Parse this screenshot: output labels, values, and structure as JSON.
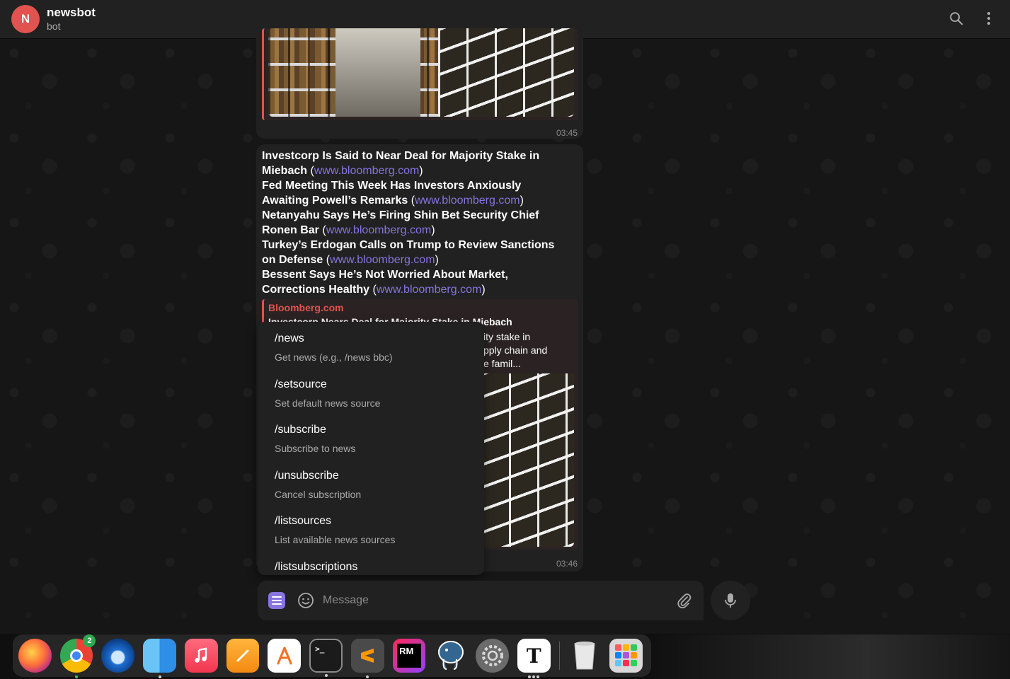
{
  "header": {
    "avatar_letter": "N",
    "title": "newsbot",
    "subtitle": "bot",
    "icons": [
      "search-icon",
      "more-vertical-icon"
    ]
  },
  "messages": {
    "first": {
      "time": "03:45"
    },
    "second": {
      "headlines": [
        {
          "title": "Investcorp Is Said to Near Deal for Majority Stake in Miebach",
          "link": "www.bloomberg.com"
        },
        {
          "title": "Fed Meeting This Week Has Investors Anxiously Awaiting Powell’s Remarks",
          "link": "www.bloomberg.com"
        },
        {
          "title": "Netanyahu Says He’s Firing Shin Bet Security Chief Ronen Bar",
          "link": "www.bloomberg.com"
        },
        {
          "title": "Turkey’s Erdogan Calls on Trump to Review Sanctions on Defense",
          "link": "www.bloomberg.com"
        },
        {
          "title": "Bessent Says He’s Not Worried About Market, Corrections Healthy",
          "link": "www.bloomberg.com"
        }
      ],
      "preview": {
        "site": "Bloomberg.com",
        "headline_partial": "Investcorp Nears Deal for Majority Stake in Miebach",
        "desc_line1": "ity stake in",
        "desc_line2": "pply chain and",
        "desc_line3": "e famil..."
      },
      "time": "03:46"
    }
  },
  "command_menu": [
    {
      "command": "/news",
      "description": "Get news (e.g., /news bbc)"
    },
    {
      "command": "/setsource",
      "description": "Set default news source"
    },
    {
      "command": "/subscribe",
      "description": "Subscribe to news"
    },
    {
      "command": "/unsubscribe",
      "description": "Cancel subscription"
    },
    {
      "command": "/listsources",
      "description": "List available news sources"
    },
    {
      "command": "/listsubscriptions",
      "description": ""
    }
  ],
  "composer": {
    "placeholder": "Message",
    "icons": [
      "bot-menu-icon",
      "emoji-icon",
      "attach-icon",
      "microphone-icon"
    ]
  },
  "dock": {
    "apps": [
      "firefox-icon",
      "chrome-icon",
      "thunderbird-icon",
      "finder-icon",
      "music-icon",
      "pages-icon",
      "app-store-icon",
      "terminal-icon",
      "sublime-text-icon",
      "rubymine-icon",
      "postgresql-icon",
      "system-settings-icon",
      "typora-icon",
      "trash-icon",
      "launchpad-icon"
    ],
    "chrome_badge": "2",
    "rubymine_label": "RM",
    "typora_label": "T",
    "terminal_label": ">_"
  },
  "colors": {
    "accent": "#8774e1",
    "avatar": "#e0534f",
    "bubble": "#212121",
    "background": "#161616"
  }
}
